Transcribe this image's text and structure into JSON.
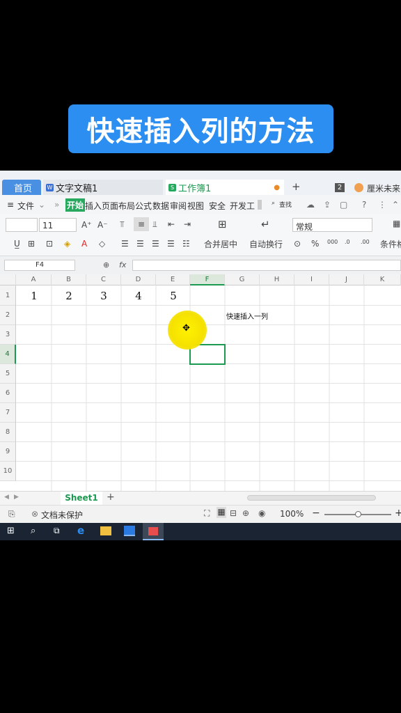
{
  "banner": {
    "title": "快速插入列的方法"
  },
  "tabs": {
    "home": "首页",
    "doc": "文字文稿1",
    "book": "工作簿1",
    "new_tab": "+",
    "badge": "2",
    "user": "厘米未来"
  },
  "menu": {
    "file": "文件",
    "items": [
      "开始",
      "插入",
      "页面布局",
      "公式",
      "数据",
      "审阅",
      "视图",
      "安全",
      "开发工"
    ],
    "search": "查找"
  },
  "ribbon": {
    "font_size": "11",
    "merge_center": "合并居中",
    "auto_wrap": "自动换行",
    "number_format": "常规",
    "conditional": "条件格",
    "percent": "%"
  },
  "formula": {
    "name_box": "F4",
    "fx": "fx",
    "content": ""
  },
  "columns": [
    "A",
    "B",
    "C",
    "D",
    "E",
    "F",
    "G",
    "H",
    "I",
    "J",
    "K"
  ],
  "rows": [
    "1",
    "2",
    "3",
    "4",
    "5",
    "6",
    "7",
    "8",
    "9",
    "10"
  ],
  "cells": {
    "A1": "1",
    "B1": "2",
    "C1": "3",
    "D1": "4",
    "E1": "5",
    "G2": "快速插入一列"
  },
  "sheet": {
    "name": "Sheet1",
    "add": "+"
  },
  "status": {
    "protect": "文档未保护",
    "zoom": "100%"
  },
  "colors": {
    "banner": "#2b8ef0",
    "accent": "#1a9a50",
    "highlight": "#ffe800"
  }
}
